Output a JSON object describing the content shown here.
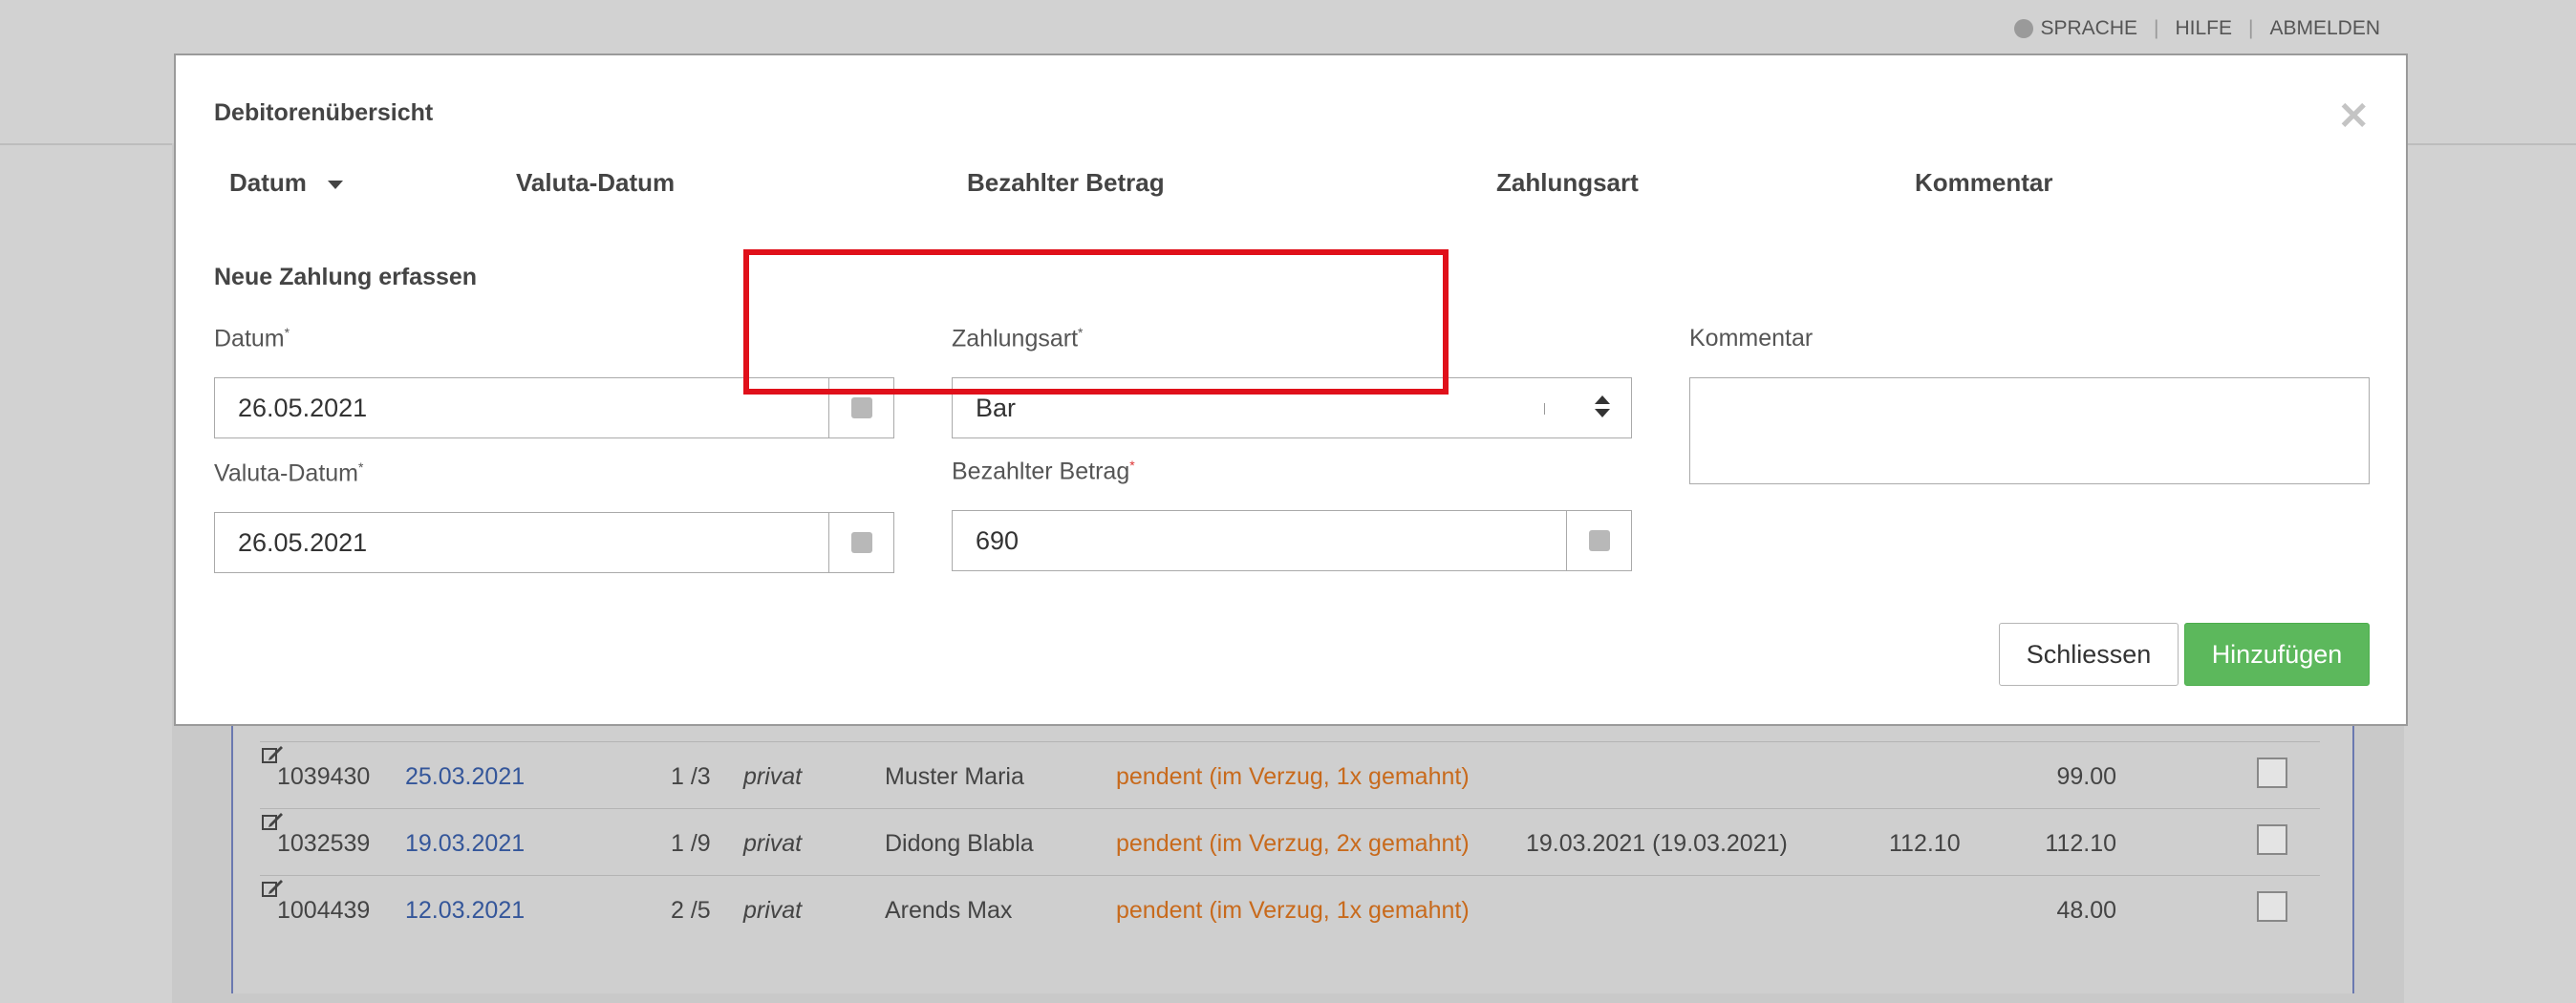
{
  "topnav": {
    "language": "SPRACHE",
    "help": "HILFE",
    "logout": "ABMELDEN",
    "separator": "|"
  },
  "modal": {
    "title": "Debitorenübersicht",
    "close_glyph": "✕",
    "table_headers": [
      "Datum",
      "Valuta-Datum",
      "Bezahlter Betrag",
      "Zahlungsart",
      "Kommentar"
    ],
    "section_title": "Neue Zahlung erfassen",
    "required_mark": "*",
    "fields": {
      "datum": {
        "label": "Datum",
        "value": "26.05.2021"
      },
      "valuta": {
        "label": "Valuta-Datum",
        "value": "26.05.2021"
      },
      "zahlungsart": {
        "label": "Zahlungsart",
        "value": "Bar"
      },
      "betrag": {
        "label": "Bezahlter Betrag",
        "value": "690"
      },
      "kommentar": {
        "label": "Kommentar",
        "value": ""
      }
    },
    "buttons": {
      "close": "Schliessen",
      "add": "Hinzufügen"
    },
    "highlight_color": "#e0101a",
    "accent_green": "#5cb85c"
  },
  "background_rows": [
    {
      "id": "1039430",
      "date": "25.03.2021",
      "fraction": "1 /3",
      "type": "privat",
      "name": "Muster Maria",
      "status": "pendent (im Verzug, 1x gemahnt)",
      "due": "",
      "amount1": "",
      "amount2": "99.00"
    },
    {
      "id": "1032539",
      "date": "19.03.2021",
      "fraction": "1 /9",
      "type": "privat",
      "name": "Didong Blabla",
      "status": "pendent (im Verzug, 2x gemahnt)",
      "due": "19.03.2021 (19.03.2021)",
      "amount1": "112.10",
      "amount2": "112.10"
    },
    {
      "id": "1004439",
      "date": "12.03.2021",
      "fraction": "2 /5",
      "type": "privat",
      "name": "Arends Max",
      "status": "pendent (im Verzug, 1x gemahnt)",
      "due": "",
      "amount1": "",
      "amount2": "48.00"
    }
  ]
}
